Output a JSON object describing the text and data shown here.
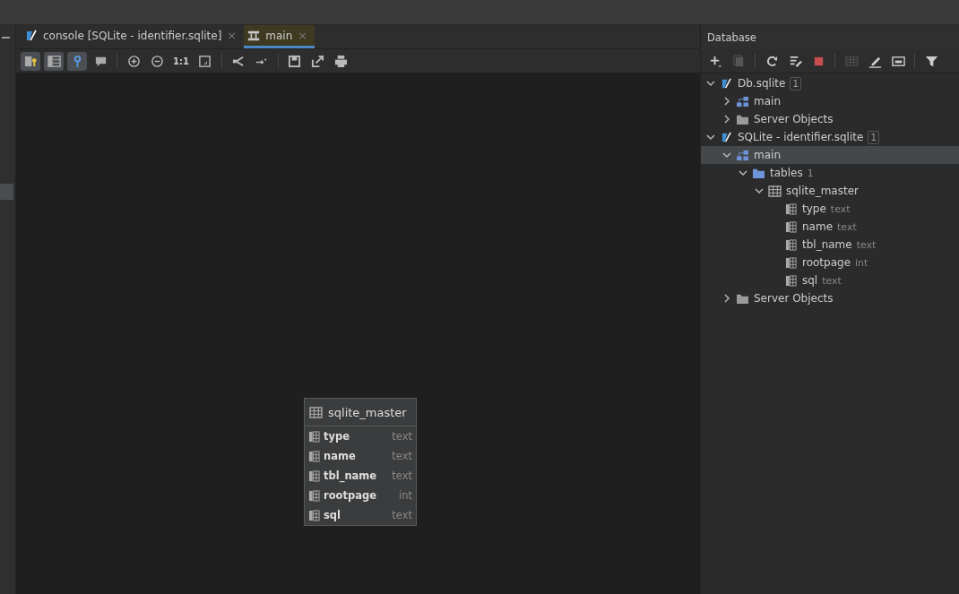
{
  "tabs": [
    {
      "label": "console [SQLite - identifier.sqlite]",
      "kind": "console",
      "selected": false,
      "close": "×"
    },
    {
      "label": "main",
      "kind": "diagram",
      "selected": true,
      "close": "×"
    }
  ],
  "toolbar": [
    {
      "kind": "columns-key",
      "selected": true
    },
    {
      "kind": "table",
      "selected": true
    },
    {
      "kind": "key",
      "selected": true
    },
    {
      "kind": "comment",
      "selected": false
    },
    {
      "kind": "sep"
    },
    {
      "kind": "zoom-in",
      "selected": false
    },
    {
      "kind": "zoom-out",
      "selected": false
    },
    {
      "kind": "text",
      "label": "1:1",
      "selected": false
    },
    {
      "kind": "fit",
      "selected": false
    },
    {
      "kind": "sep"
    },
    {
      "kind": "layout",
      "selected": false
    },
    {
      "kind": "route",
      "selected": false
    },
    {
      "kind": "sep"
    },
    {
      "kind": "save",
      "selected": false
    },
    {
      "kind": "export",
      "selected": false
    },
    {
      "kind": "print",
      "selected": false
    }
  ],
  "diagram": {
    "table": {
      "title": "sqlite_master",
      "columns": [
        {
          "name": "type",
          "type": "text"
        },
        {
          "name": "name",
          "type": "text"
        },
        {
          "name": "tbl_name",
          "type": "text"
        },
        {
          "name": "rootpage",
          "type": "int"
        },
        {
          "name": "sql",
          "type": "text"
        }
      ]
    }
  },
  "database_panel": {
    "title": "Database",
    "toolbar": [
      {
        "kind": "add"
      },
      {
        "kind": "copy"
      },
      {
        "kind": "sep"
      },
      {
        "kind": "refresh"
      },
      {
        "kind": "properties"
      },
      {
        "kind": "stop"
      },
      {
        "kind": "sep"
      },
      {
        "kind": "grid"
      },
      {
        "kind": "edit"
      },
      {
        "kind": "console"
      },
      {
        "kind": "sep"
      },
      {
        "kind": "filter"
      }
    ],
    "tree": [
      {
        "kind": "datasource",
        "label": "Db.sqlite",
        "badge": "1",
        "expanded": true,
        "selected": false,
        "children": [
          {
            "kind": "schema",
            "label": "main",
            "expanded": false,
            "selected": false
          },
          {
            "kind": "folder",
            "label": "Server Objects",
            "expanded": false,
            "selected": false
          }
        ]
      },
      {
        "kind": "datasource",
        "label": "SQLite - identifier.sqlite",
        "badge": "1",
        "expanded": true,
        "selected": false,
        "children": [
          {
            "kind": "schema",
            "label": "main",
            "expanded": true,
            "selected": true,
            "children": [
              {
                "kind": "folder-blue",
                "label": "tables",
                "count": "1",
                "expanded": true,
                "selected": false,
                "children": [
                  {
                    "kind": "table",
                    "label": "sqlite_master",
                    "expanded": true,
                    "selected": false,
                    "children": [
                      {
                        "kind": "column",
                        "label": "type",
                        "type": "text",
                        "selected": false
                      },
                      {
                        "kind": "column",
                        "label": "name",
                        "type": "text",
                        "selected": false
                      },
                      {
                        "kind": "column",
                        "label": "tbl_name",
                        "type": "text",
                        "selected": false
                      },
                      {
                        "kind": "column",
                        "label": "rootpage",
                        "type": "int",
                        "selected": false
                      },
                      {
                        "kind": "column",
                        "label": "sql",
                        "type": "text",
                        "selected": false
                      }
                    ]
                  }
                ]
              }
            ]
          },
          {
            "kind": "folder",
            "label": "Server Objects",
            "expanded": false,
            "selected": false
          }
        ]
      }
    ]
  }
}
